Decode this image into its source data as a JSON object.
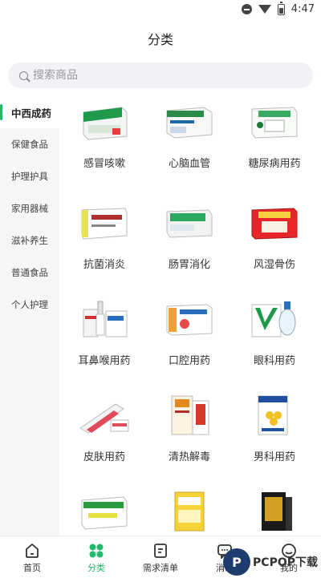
{
  "status_bar": {
    "time": "4:47"
  },
  "header": {
    "title": "分类"
  },
  "search": {
    "placeholder": "搜索商品"
  },
  "sidebar": {
    "items": [
      {
        "label": "中西成药",
        "active": true
      },
      {
        "label": "保健食品",
        "active": false
      },
      {
        "label": "护理护具",
        "active": false
      },
      {
        "label": "家用器械",
        "active": false
      },
      {
        "label": "滋补养生",
        "active": false
      },
      {
        "label": "普通食品",
        "active": false
      },
      {
        "label": "个人护理",
        "active": false
      }
    ]
  },
  "categories": [
    {
      "label": "感冒咳嗽",
      "icon": "cold-medicine-box-icon"
    },
    {
      "label": "心脑血管",
      "icon": "cardio-medicine-box-icon"
    },
    {
      "label": "糖尿病用药",
      "icon": "diabetes-medicine-box-icon"
    },
    {
      "label": "抗菌消炎",
      "icon": "antibiotic-box-icon"
    },
    {
      "label": "肠胃消化",
      "icon": "digestive-medicine-box-icon"
    },
    {
      "label": "风湿骨伤",
      "icon": "rheumatism-medicine-box-icon"
    },
    {
      "label": "耳鼻喉用药",
      "icon": "ent-spray-icon"
    },
    {
      "label": "口腔用药",
      "icon": "oral-medicine-box-icon"
    },
    {
      "label": "眼科用药",
      "icon": "eye-drops-icon"
    },
    {
      "label": "皮肤用药",
      "icon": "skin-ointment-icon"
    },
    {
      "label": "清热解毒",
      "icon": "heat-clearing-medicine-box-icon"
    },
    {
      "label": "男科用药",
      "icon": "andrology-medicine-box-icon"
    },
    {
      "label": "",
      "icon": "green-pill-box-icon"
    },
    {
      "label": "",
      "icon": "yellow-medicine-box-icon"
    },
    {
      "label": "",
      "icon": "black-medicine-box-icon"
    }
  ],
  "tabbar": {
    "items": [
      {
        "label": "首页",
        "icon": "home-icon",
        "active": false
      },
      {
        "label": "分类",
        "icon": "category-grid-icon",
        "active": true
      },
      {
        "label": "需求清单",
        "icon": "list-icon",
        "active": false
      },
      {
        "label": "消息",
        "icon": "message-icon",
        "active": false
      },
      {
        "label": "我的",
        "icon": "profile-icon",
        "active": false
      }
    ]
  },
  "watermark": {
    "text": "PCPOP下载"
  },
  "colors": {
    "accent": "#23b96b",
    "sidebar_bg": "#f5f6f8"
  }
}
